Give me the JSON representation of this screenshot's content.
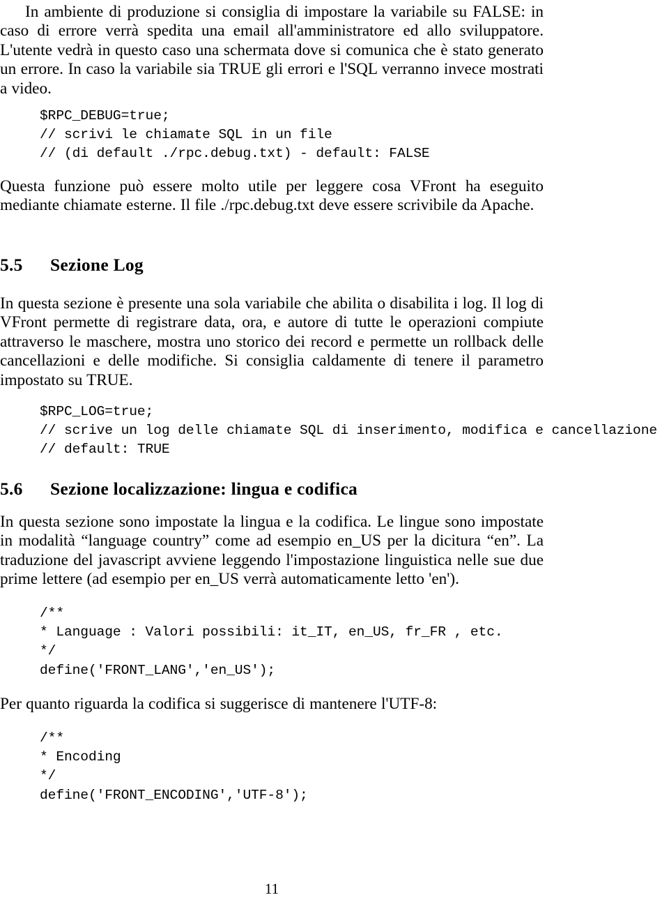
{
  "document": {
    "page_number": "11",
    "language": "it"
  },
  "blocks": {
    "intro_paragraph": "In ambiente di produzione si consiglia di impostare la variabile su FALSE: in caso di errore verrà spedita una email all'amministratore ed allo sviluppatore. L'utente vedrà in questo caso una schermata dove si comunica che è stato generato un errore. In caso la variabile sia TRUE gli errori e l'SQL verranno invece mostrati a video.",
    "code_rpc_debug": "$RPC_DEBUG=true;\n// scrivi le chiamate SQL in un file\n// (di default ./rpc.debug.txt) - default: FALSE",
    "after_debug_paragraph": "Questa funzione può essere molto utile per leggere cosa VFront ha eseguito mediante chiamate esterne. Il file ./rpc.debug.txt deve essere scrivibile da Apache.",
    "section_55_number": "5.5",
    "section_55_title": "Sezione Log",
    "section_55_paragraph": "In questa sezione è presente una sola variabile che abilita o disabilita i log. Il log di VFront permette di registrare data, ora, e autore di tutte le operazioni compiute attraverso le maschere, mostra uno storico dei record e permette un rollback delle cancellazioni e delle modifiche. Si consiglia caldamente di tenere il parametro impostato su TRUE.",
    "code_rpc_log": "$RPC_LOG=true;\n// scrive un log delle chiamate SQL di inserimento, modifica e cancellazione\n// default: TRUE",
    "section_56_number": "5.6",
    "section_56_title": "Sezione localizzazione: lingua e codifica",
    "section_56_paragraph": "In questa sezione sono impostate la lingua e la codifica. Le lingue sono impostate in modalità “language country” come ad esempio en_US per la dicitura “en”. La traduzione del javascript avviene leggendo l'impostazione linguistica nelle sue due prime lettere (ad esempio per en_US verrà automaticamente letto 'en').",
    "code_front_lang": "/**\n* Language : Valori possibili: it_IT, en_US, fr_FR , etc.\n*/\ndefine('FRONT_LANG','en_US');",
    "encoding_paragraph": "Per quanto riguarda la codifica si suggerisce di mantenere l'UTF-8:",
    "code_front_encoding": "/**\n* Encoding\n*/\ndefine('FRONT_ENCODING','UTF-8');"
  }
}
